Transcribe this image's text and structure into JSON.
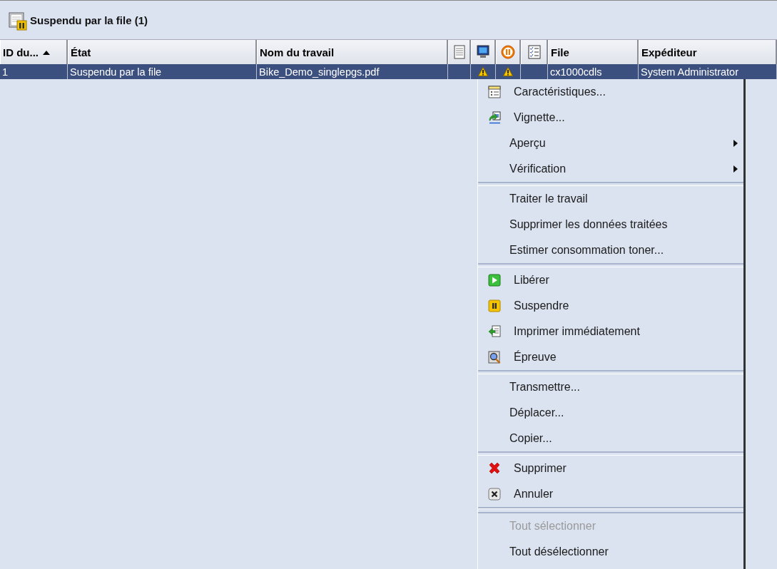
{
  "panel": {
    "title": "Suspendu par la file (1)"
  },
  "table": {
    "columns": [
      {
        "kind": "text",
        "label": "ID du...",
        "sorted": true
      },
      {
        "kind": "text",
        "label": "État",
        "sorted": false
      },
      {
        "kind": "text",
        "label": "Nom du travail",
        "sorted": false
      },
      {
        "kind": "icon",
        "sorted": false
      },
      {
        "kind": "icon",
        "sorted": false
      },
      {
        "kind": "icon",
        "sorted": false
      },
      {
        "kind": "icon",
        "sorted": false
      },
      {
        "kind": "text",
        "label": "File",
        "sorted": false
      },
      {
        "kind": "text",
        "label": "Expéditeur",
        "sorted": false
      }
    ],
    "rows": [
      {
        "selected": true,
        "cells": [
          {
            "kind": "text",
            "text": "1"
          },
          {
            "kind": "text",
            "text": "Suspendu par la file"
          },
          {
            "kind": "text",
            "text": "Bike_Demo_singlepgs.pdf"
          },
          {
            "kind": "empty"
          },
          {
            "kind": "warning"
          },
          {
            "kind": "warning"
          },
          {
            "kind": "empty"
          },
          {
            "kind": "text",
            "text": "cx1000cdls"
          },
          {
            "kind": "text",
            "text": "System Administrator"
          }
        ]
      }
    ]
  },
  "context_menu": {
    "items": [
      {
        "kind": "icon-item",
        "label": "Caractéristiques...",
        "disabled": false
      },
      {
        "kind": "icon-item",
        "label": "Vignette...",
        "disabled": false
      },
      {
        "kind": "submenu",
        "label": "Aperçu",
        "disabled": false
      },
      {
        "kind": "submenu",
        "label": "Vérification",
        "disabled": false
      },
      {
        "kind": "separator"
      },
      {
        "kind": "item",
        "label": "Traiter le travail",
        "disabled": false
      },
      {
        "kind": "item",
        "label": "Supprimer les données traitées",
        "disabled": false
      },
      {
        "kind": "item",
        "label": "Estimer consommation toner...",
        "disabled": false
      },
      {
        "kind": "separator"
      },
      {
        "kind": "icon-item",
        "label": "Libérer",
        "disabled": false
      },
      {
        "kind": "icon-item",
        "label": "Suspendre",
        "disabled": false
      },
      {
        "kind": "icon-item",
        "label": "Imprimer immédiatement",
        "disabled": false
      },
      {
        "kind": "icon-item",
        "label": "Épreuve",
        "disabled": false
      },
      {
        "kind": "separator"
      },
      {
        "kind": "item",
        "label": "Transmettre...",
        "disabled": false
      },
      {
        "kind": "item",
        "label": "Déplacer...",
        "disabled": false
      },
      {
        "kind": "item",
        "label": "Copier...",
        "disabled": false
      },
      {
        "kind": "separator"
      },
      {
        "kind": "icon-item",
        "label": "Supprimer",
        "disabled": false
      },
      {
        "kind": "icon-item",
        "label": "Annuler",
        "disabled": false
      },
      {
        "kind": "double-separator"
      },
      {
        "kind": "item",
        "label": "Tout sélectionner",
        "disabled": true
      },
      {
        "kind": "item",
        "label": "Tout désélectionner",
        "disabled": false
      }
    ]
  }
}
